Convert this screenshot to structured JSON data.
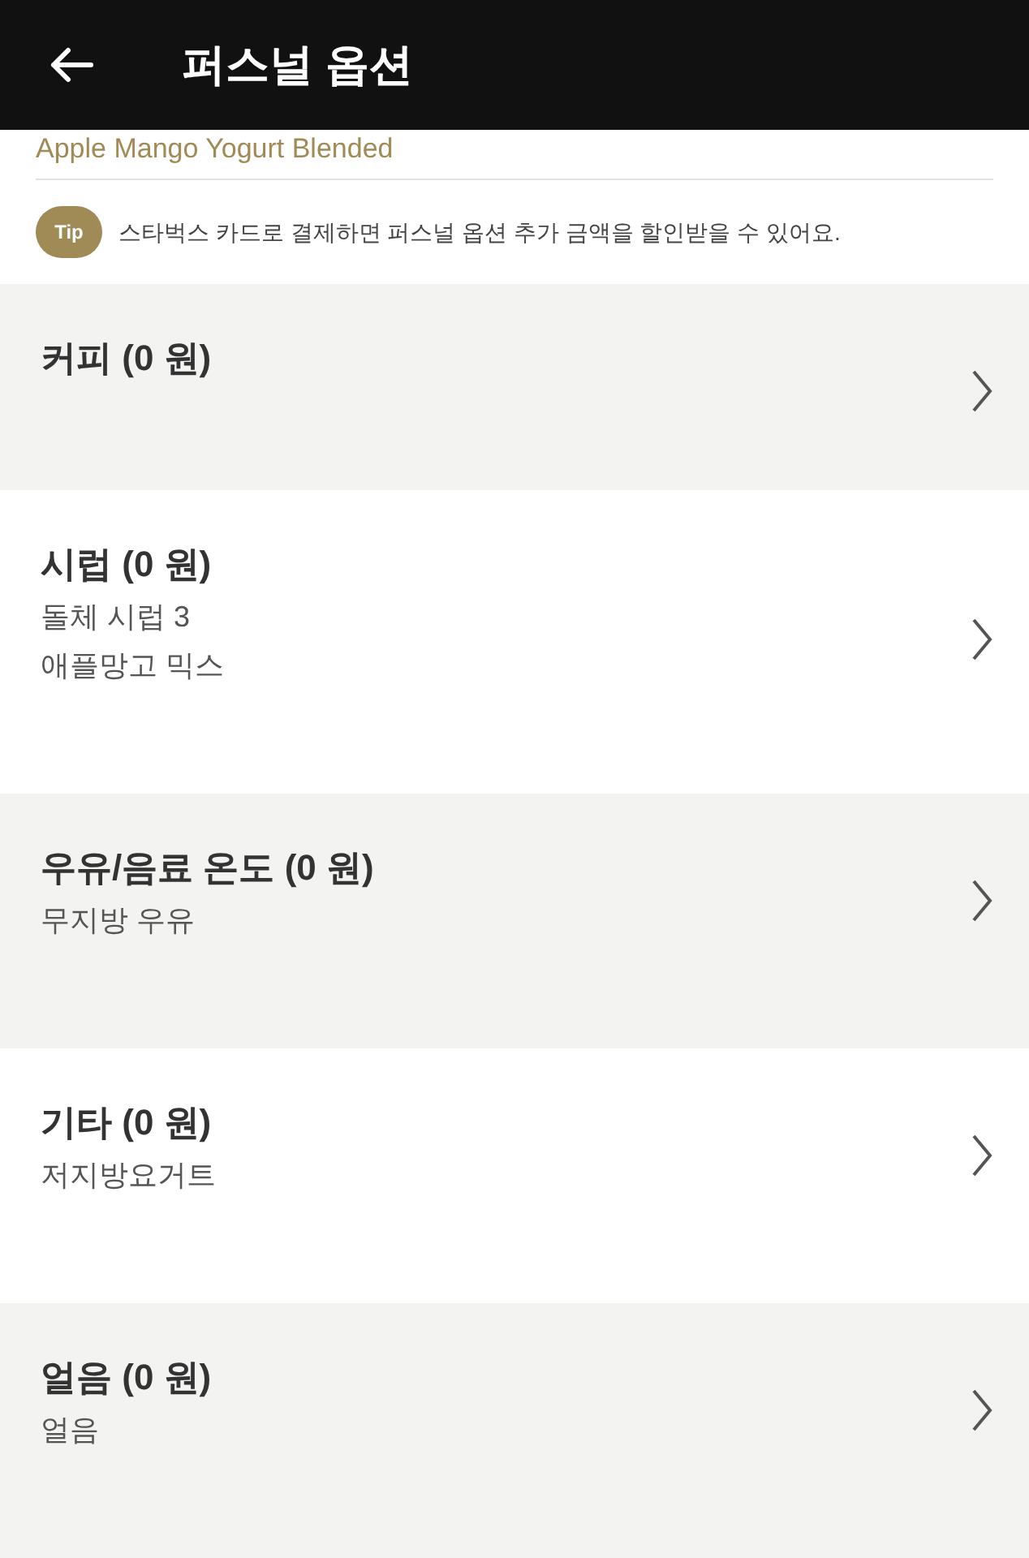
{
  "header": {
    "title": "퍼스널 옵션"
  },
  "product_name": "Apple Mango Yogurt Blended",
  "tip": {
    "badge": "Tip",
    "text": "스타벅스 카드로 결제하면 퍼스널 옵션 추가 금액을 할인받을 수 있어요."
  },
  "options": [
    {
      "title": "커피 (0 원)"
    },
    {
      "title": "시럽 (0 원)",
      "details": [
        "돌체 시럽 3",
        "애플망고 믹스"
      ]
    },
    {
      "title": "우유/음료 온도 (0 원)",
      "details": [
        "무지방 우유"
      ]
    },
    {
      "title": "기타 (0 원)",
      "details": [
        "저지방요거트"
      ]
    },
    {
      "title": "얼음 (0 원)",
      "details": [
        "얼음"
      ]
    }
  ]
}
